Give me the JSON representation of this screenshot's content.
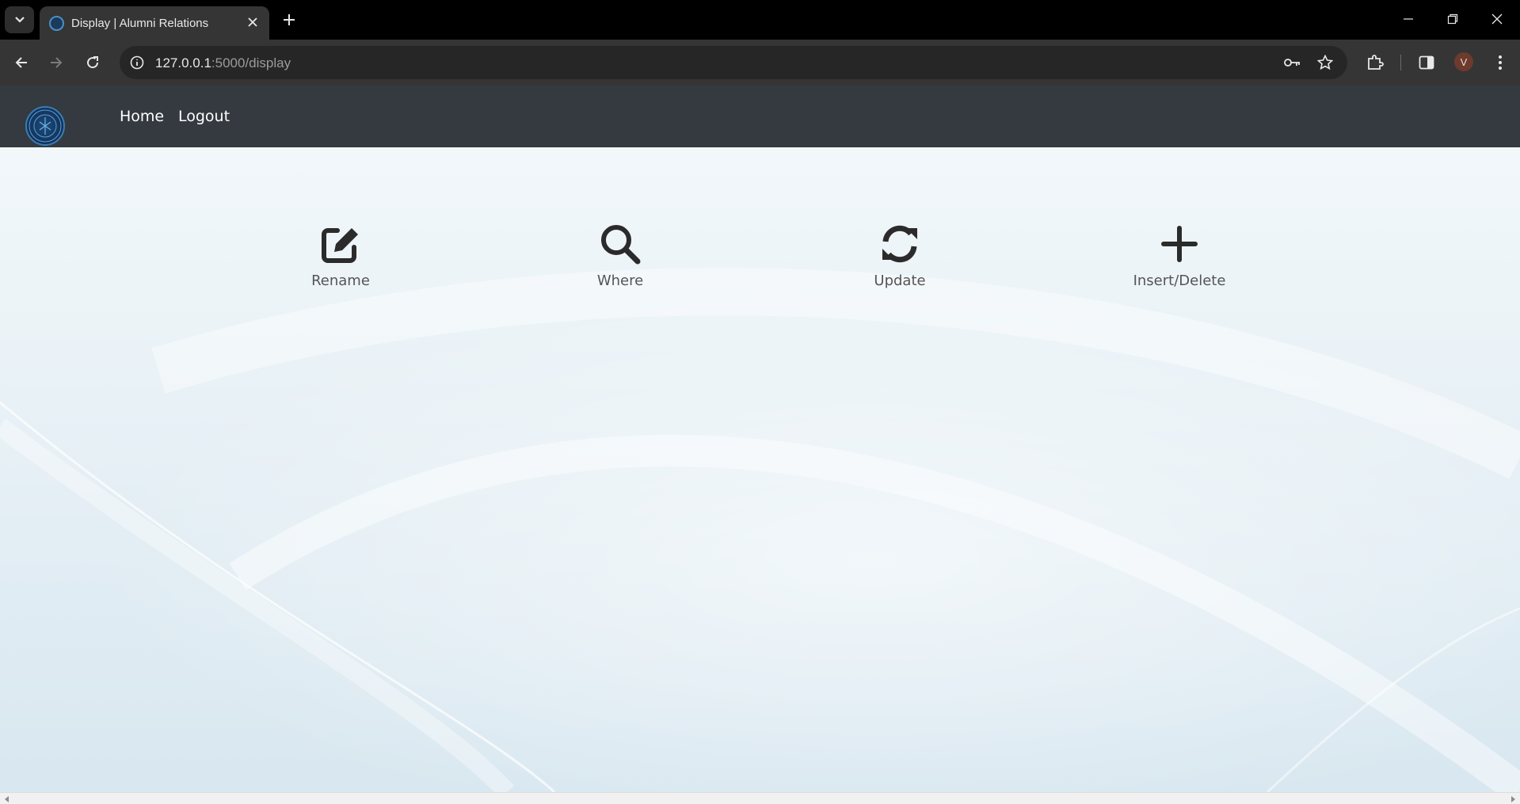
{
  "browser": {
    "tab_title": "Display | Alumni Relations",
    "url_host": "127.0.0.1",
    "url_rest": ":5000/display",
    "profile_initial": "V"
  },
  "site": {
    "nav": [
      "Home",
      "Logout"
    ]
  },
  "actions": [
    {
      "label": "Rename",
      "icon": "edit-icon"
    },
    {
      "label": "Where",
      "icon": "search-icon"
    },
    {
      "label": "Update",
      "icon": "sync-icon"
    },
    {
      "label": "Insert/Delete",
      "icon": "plus-icon"
    }
  ]
}
